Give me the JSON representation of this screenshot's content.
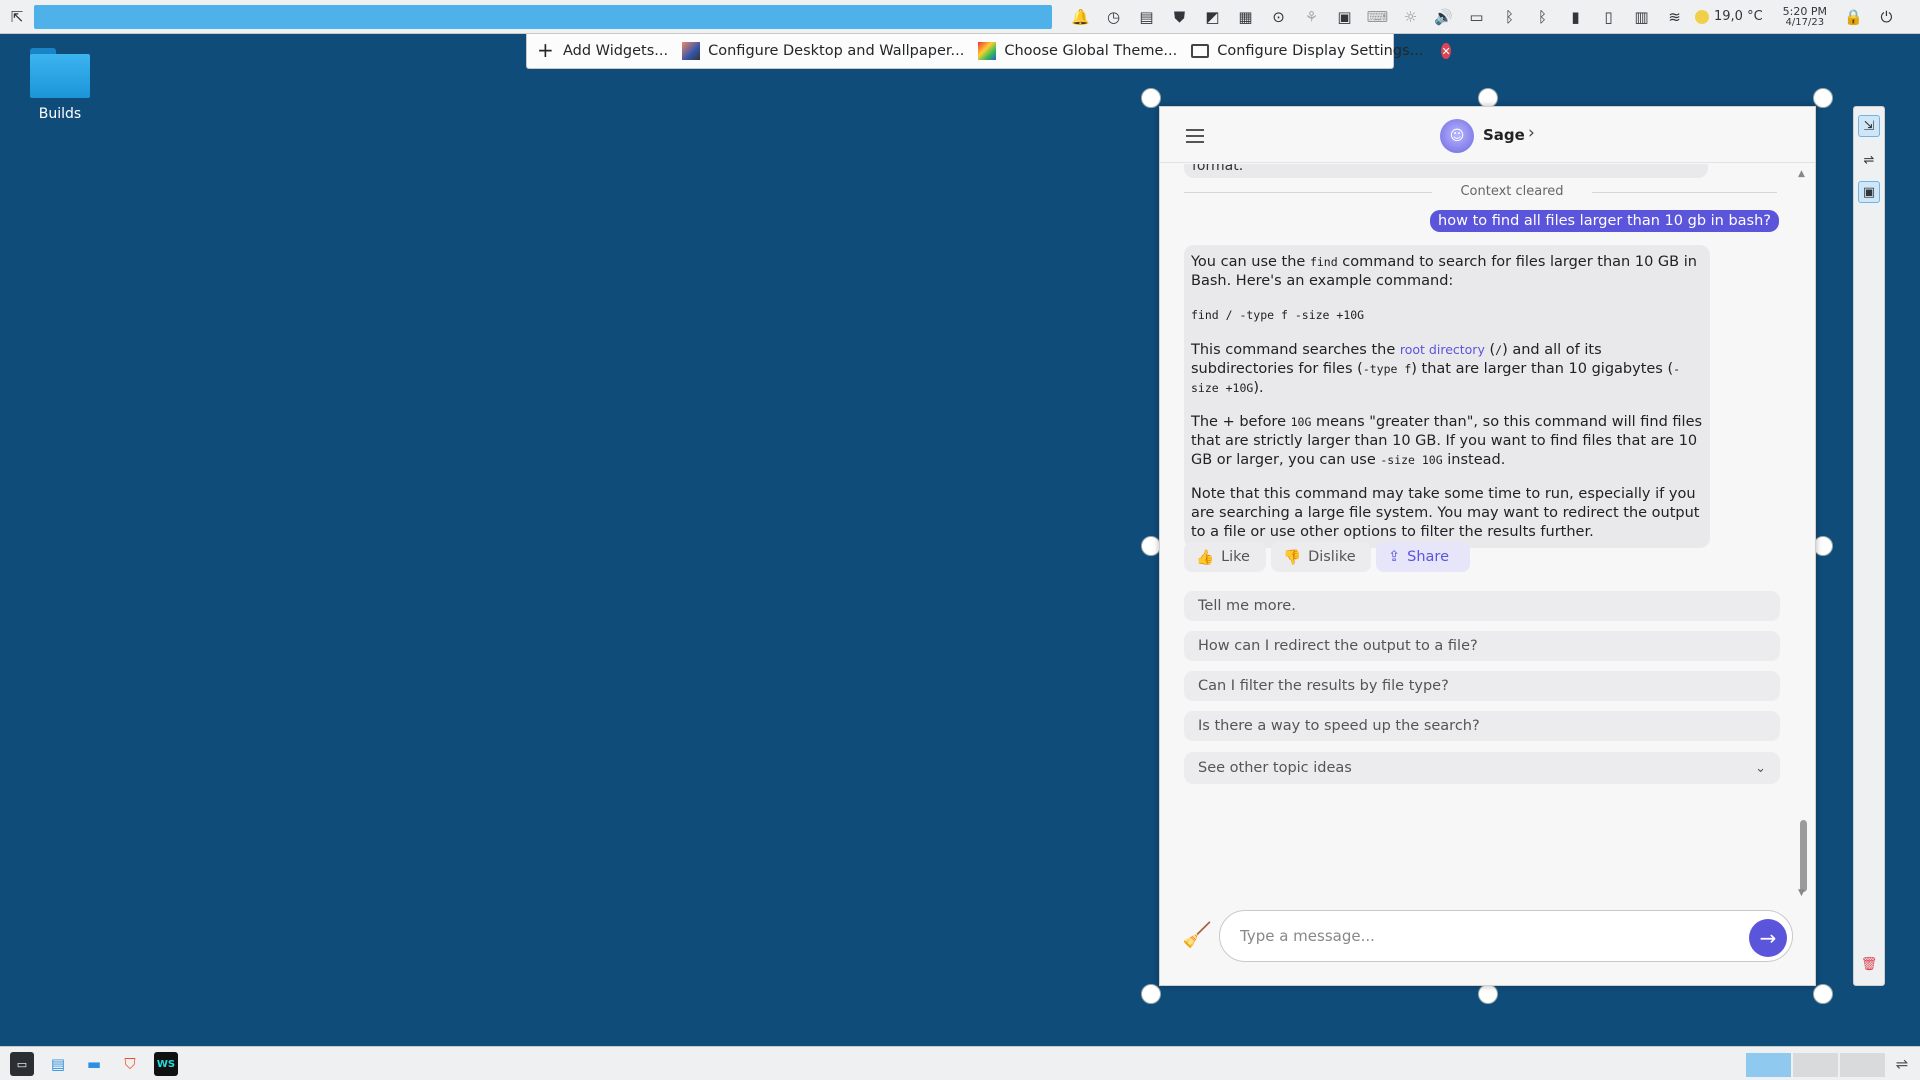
{
  "desktop": {
    "icons": [
      {
        "label": "Builds",
        "icon": "folder-icon"
      }
    ]
  },
  "top_panel": {
    "tray_icons": [
      "notifications-icon",
      "clock-icon",
      "clipboard-icon",
      "shield-icon",
      "app-icon",
      "notes-icon",
      "accessibility-icon",
      "clipboard2-icon",
      "keyboard-icon",
      "bulb-icon",
      "volume-icon",
      "battery-icon",
      "bluetooth-icon",
      "bluetooth2-icon",
      "usb-icon",
      "device-icon",
      "disk-icon",
      "wifi-icon"
    ],
    "weather": "19,0 °C",
    "time": "5:20 PM",
    "date": "4/17/23",
    "end_icons": [
      "lock-icon",
      "power-icon"
    ]
  },
  "edit_toolbar": {
    "items": [
      {
        "label": "Add Widgets...",
        "icon": "plus-icon"
      },
      {
        "label": "Configure Desktop and Wallpaper...",
        "icon": "desktop-config-icon"
      },
      {
        "label": "Choose Global Theme...",
        "icon": "theme-icon"
      },
      {
        "label": "Configure Display Settings...",
        "icon": "display-icon"
      }
    ],
    "close_icon": "close-icon"
  },
  "chat": {
    "bot_name": "Sage",
    "cut_message": "format.",
    "context_label": "Context cleared",
    "user_message": "how to find all files larger than 10 gb in bash?",
    "response": {
      "p1_a": "You can use the ",
      "p1_code": "find",
      "p1_b": " command to search for files larger than 10 GB in Bash. Here's an example command:",
      "code_block": "find / -type f -size +10G",
      "p3_a": "This command searches the ",
      "p3_link": "root directory",
      "p3_b": " (",
      "p3_code1": "/",
      "p3_c": ") and all of its subdirectories for files (",
      "p3_code2": "-type f",
      "p3_d": ") that are larger than 10 gigabytes (",
      "p3_code3": "-size +10G",
      "p3_e": ").",
      "p4_a": "The + before ",
      "p4_code1": "10G",
      "p4_b": " means \"greater than\", so this command will find files that are strictly larger than 10 GB. If you want to find files that are 10 GB or larger, you can use ",
      "p4_code2": "-size 10G",
      "p4_c": " instead.",
      "p5": "Note that this command may take some time to run, especially if you are searching a large file system. You may want to redirect the output to a file or use other options to filter the results further."
    },
    "reactions": {
      "like": "Like",
      "dislike": "Dislike",
      "share": "Share"
    },
    "suggestions": [
      "Tell me more.",
      "How can I redirect the output to a file?",
      "Can I filter the results by file type?",
      "Is there a way to speed up the search?"
    ],
    "see_more": "See other topic ideas",
    "input_placeholder": "Type a message..."
  },
  "colors": {
    "accent": "#5a55da",
    "desktop": "#104c7a",
    "panel_bar": "#4fb1e9"
  }
}
